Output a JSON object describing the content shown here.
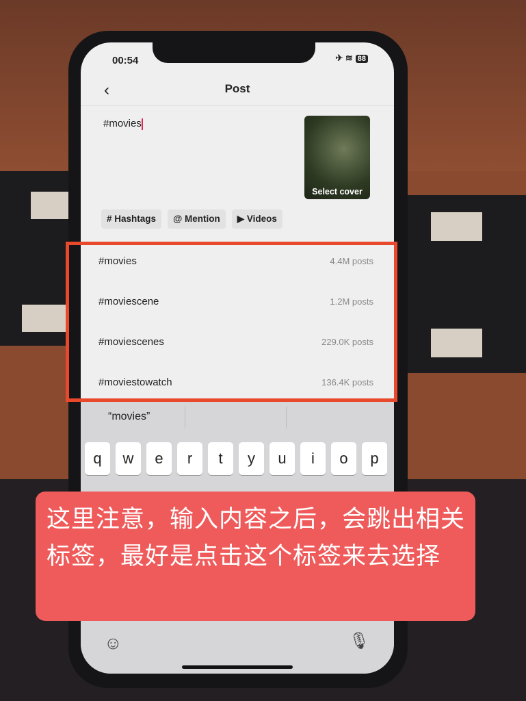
{
  "status_bar": {
    "time": "00:54",
    "battery": "88",
    "icons": [
      "airplane-icon",
      "wifi-icon",
      "battery-icon"
    ]
  },
  "header": {
    "title": "Post",
    "back_icon": "chevron-left-icon"
  },
  "composer": {
    "text": "#movies",
    "cover_label": "Select cover"
  },
  "chips": [
    {
      "icon": "#",
      "label": "Hashtags"
    },
    {
      "icon": "@",
      "label": "Mention"
    },
    {
      "icon": "▶",
      "label": "Videos"
    }
  ],
  "suggestions": [
    {
      "tag": "#movies",
      "count": "4.4M posts"
    },
    {
      "tag": "#moviescene",
      "count": "1.2M posts"
    },
    {
      "tag": "#moviescenes",
      "count": "229.0K posts"
    },
    {
      "tag": "#moviestowatch",
      "count": "136.4K posts"
    }
  ],
  "keyboard": {
    "prediction": "“movies”",
    "row1": [
      "q",
      "w",
      "e",
      "r",
      "t",
      "y",
      "u",
      "i",
      "o",
      "p"
    ]
  },
  "annotation": {
    "text": "这里注意，输入内容之后，会跳出相关标签，最好是点击这个标签来去选择",
    "highlight_color": "#e8482b",
    "note_color": "#ef5b5b"
  }
}
